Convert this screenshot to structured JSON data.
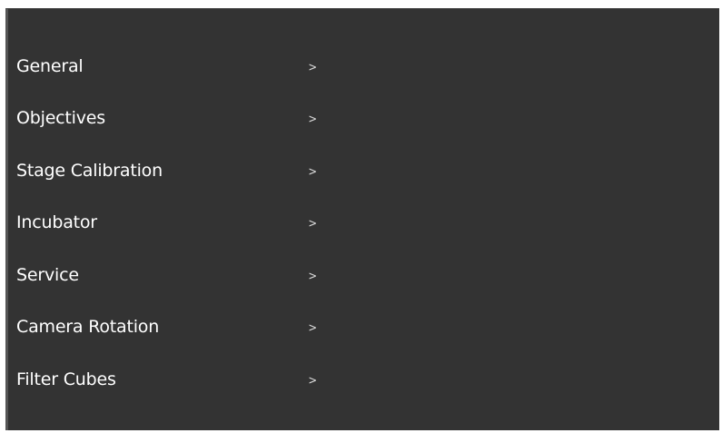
{
  "settings_menu": {
    "items": [
      {
        "label": "General",
        "chevron": ">"
      },
      {
        "label": "Objectives",
        "chevron": ">"
      },
      {
        "label": "Stage Calibration",
        "chevron": ">"
      },
      {
        "label": "Incubator",
        "chevron": ">"
      },
      {
        "label": "Service",
        "chevron": ">"
      },
      {
        "label": "Camera Rotation",
        "chevron": ">"
      },
      {
        "label": "Filter Cubes",
        "chevron": ">"
      }
    ]
  },
  "colors": {
    "panel_background": "#333333",
    "text": "#ffffff",
    "chevron": "#d9d9d9"
  }
}
